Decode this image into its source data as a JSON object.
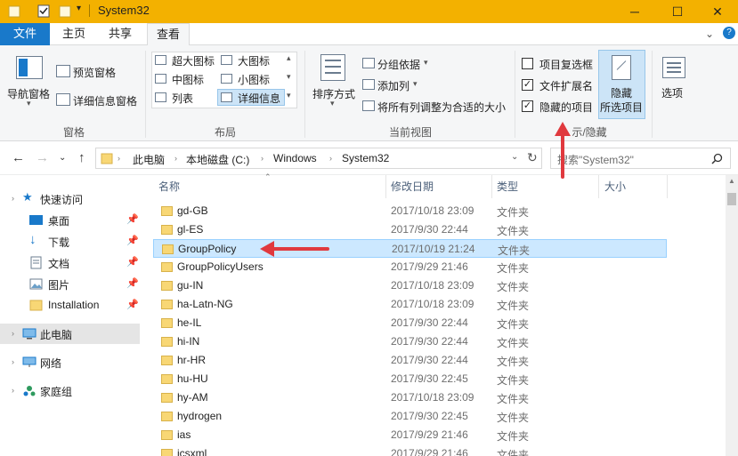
{
  "window": {
    "title": "System32",
    "minimize": "─",
    "maximize": "☐",
    "close": "✕"
  },
  "tabs": {
    "file": "文件",
    "home": "主页",
    "share": "共享",
    "view": "查看"
  },
  "ribbon": {
    "panes": {
      "nav_pane": "导航窗格",
      "preview_pane": "预览窗格",
      "details_pane": "详细信息窗格",
      "label": "窗格"
    },
    "layout": {
      "xl_icons": "超大图标",
      "l_icons": "大图标",
      "m_icons": "中图标",
      "s_icons": "小图标",
      "list": "列表",
      "details": "详细信息",
      "label": "布局"
    },
    "current_view": {
      "sort_by": "排序方式",
      "group_by": "分组依据",
      "add_columns": "添加列",
      "fit_columns": "将所有列调整为合适的大小",
      "label": "当前视图"
    },
    "show_hide": {
      "item_checkboxes": "项目复选框",
      "file_extensions": "文件扩展名",
      "hidden_items": "隐藏的项目",
      "hide_selected_1": "隐藏",
      "hide_selected_2": "所选项目",
      "label": "示/隐藏",
      "item_checkboxes_checked": false,
      "file_extensions_checked": true,
      "hidden_items_checked": true
    },
    "options": "选项"
  },
  "address": {
    "crumbs": [
      "此电脑",
      "本地磁盘 (C:)",
      "Windows",
      "System32"
    ],
    "search_placeholder": "搜索\"System32\""
  },
  "nav": {
    "quick_access": "快速访问",
    "desktop": "桌面",
    "downloads": "下载",
    "documents": "文档",
    "pictures": "图片",
    "installation": "Installation",
    "this_pc": "此电脑",
    "network": "网络",
    "homegroup": "家庭组"
  },
  "columns": {
    "name": "名称",
    "date": "修改日期",
    "type": "类型",
    "size": "大小"
  },
  "files": [
    {
      "name": "gd-GB",
      "date": "2017/10/18 23:09",
      "type": "文件夹"
    },
    {
      "name": "gl-ES",
      "date": "2017/9/30 22:44",
      "type": "文件夹"
    },
    {
      "name": "GroupPolicy",
      "date": "2017/10/19 21:24",
      "type": "文件夹"
    },
    {
      "name": "GroupPolicyUsers",
      "date": "2017/9/29 21:46",
      "type": "文件夹"
    },
    {
      "name": "gu-IN",
      "date": "2017/10/18 23:09",
      "type": "文件夹"
    },
    {
      "name": "ha-Latn-NG",
      "date": "2017/10/18 23:09",
      "type": "文件夹"
    },
    {
      "name": "he-IL",
      "date": "2017/9/30 22:44",
      "type": "文件夹"
    },
    {
      "name": "hi-IN",
      "date": "2017/9/30 22:44",
      "type": "文件夹"
    },
    {
      "name": "hr-HR",
      "date": "2017/9/30 22:44",
      "type": "文件夹"
    },
    {
      "name": "hu-HU",
      "date": "2017/9/30 22:45",
      "type": "文件夹"
    },
    {
      "name": "hy-AM",
      "date": "2017/10/18 23:09",
      "type": "文件夹"
    },
    {
      "name": "hydrogen",
      "date": "2017/9/30 22:45",
      "type": "文件夹"
    },
    {
      "name": "ias",
      "date": "2017/9/29 21:46",
      "type": "文件夹"
    },
    {
      "name": "icsxml",
      "date": "2017/9/29 21:46",
      "type": "文件夹"
    }
  ],
  "colors": {
    "titlebar": "#f3b100",
    "file_tab": "#1979ca",
    "selection": "#cce8ff",
    "arrow": "#e0393e",
    "folder": "#f8d775"
  }
}
